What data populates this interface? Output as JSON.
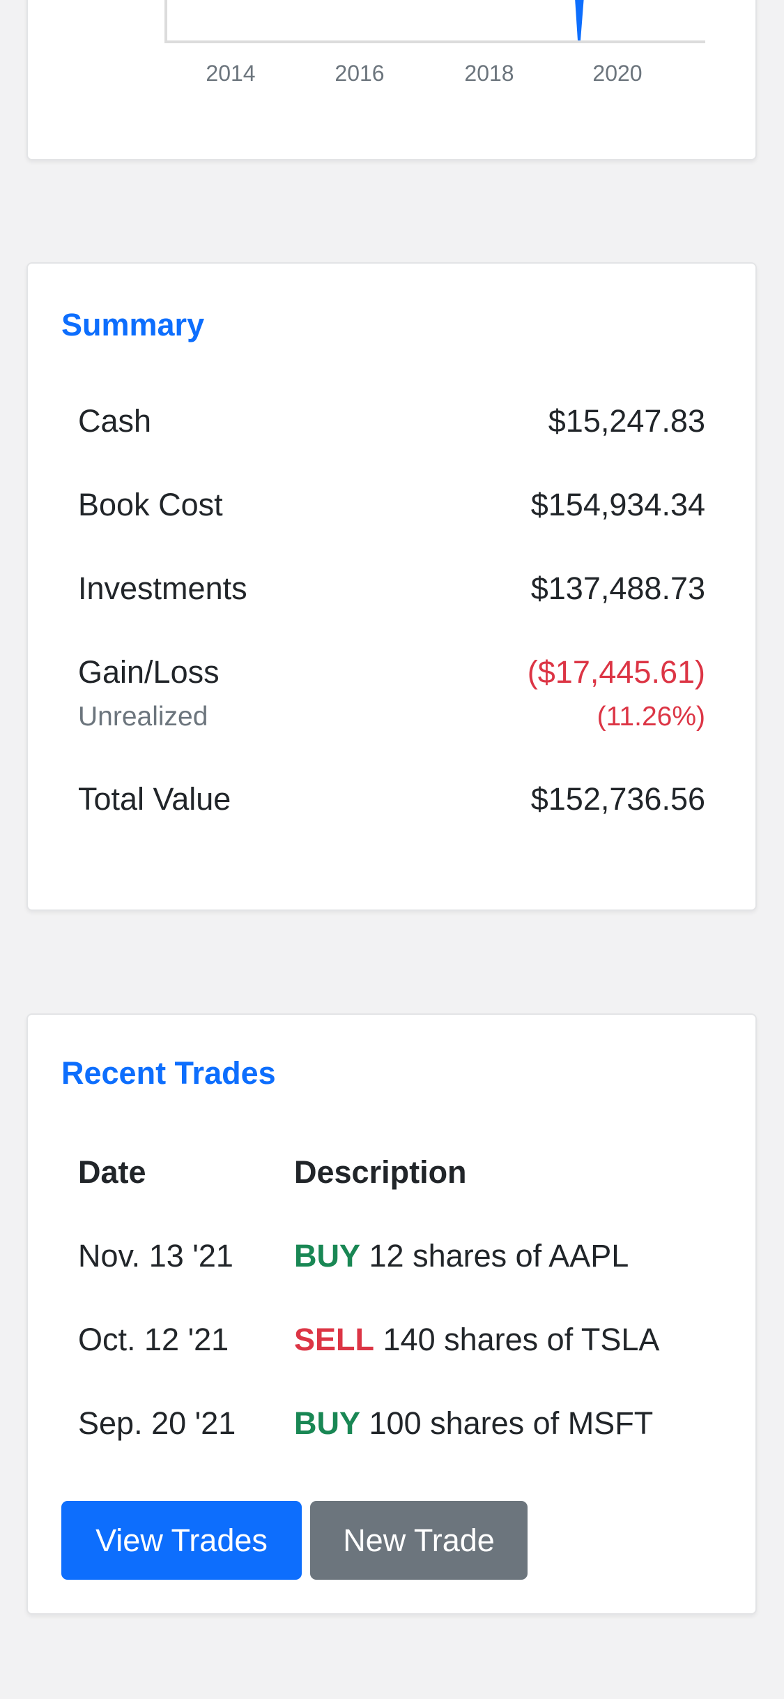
{
  "chart": {
    "x_ticks": [
      "2014",
      "2016",
      "2018",
      "2020"
    ],
    "colors": {
      "line": "#0d6efd",
      "axis": "#dcdcdc",
      "tick_text": "#6c757d"
    }
  },
  "summary": {
    "title": "Summary",
    "rows": [
      {
        "label": "Cash",
        "value": "$15,247.83"
      },
      {
        "label": "Book Cost",
        "value": "$154,934.34"
      },
      {
        "label": "Investments",
        "value": "$137,488.73"
      },
      {
        "label": "Gain/Loss",
        "value": "($17,445.61)",
        "sublabel": "Unrealized",
        "subvalue": "(11.26%)"
      },
      {
        "label": "Total Value",
        "value": "$152,736.56"
      }
    ]
  },
  "trades": {
    "title": "Recent Trades",
    "headers": {
      "date": "Date",
      "description": "Description"
    },
    "rows": [
      {
        "date": "Nov. 13 '21",
        "action": "BUY",
        "detail": " 12 shares of AAPL"
      },
      {
        "date": "Oct. 12 '21",
        "action": "SELL",
        "detail": " 140 shares of TSLA"
      },
      {
        "date": "Sep. 20 '21",
        "action": "BUY",
        "detail": " 100 shares of MSFT"
      }
    ],
    "view_button": "View Trades",
    "new_button": "New Trade"
  },
  "colors": {
    "accent": "#0d6efd",
    "buy": "#198754",
    "sell": "#dc3545",
    "secondary": "#6c757d"
  }
}
